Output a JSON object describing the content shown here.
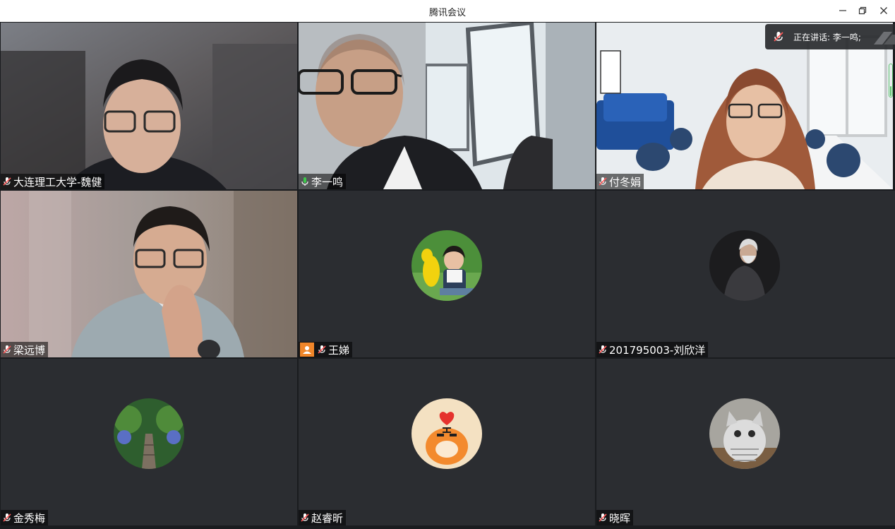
{
  "window": {
    "title": "腾讯会议"
  },
  "speaking_indicator": {
    "label": "正在讲话: 李一鸣;"
  },
  "participants": [
    {
      "name": "大连理工大学-魏健",
      "mic": "muted"
    },
    {
      "name": "李一鸣",
      "mic": "active"
    },
    {
      "name": "付冬娟",
      "mic": "muted"
    },
    {
      "name": "梁远博",
      "mic": "muted"
    },
    {
      "name": "王娣",
      "mic": "muted"
    },
    {
      "name": "201795003-刘欣洋",
      "mic": "muted"
    },
    {
      "name": "金秀梅",
      "mic": "muted"
    },
    {
      "name": "赵睿昕",
      "mic": "muted"
    },
    {
      "name": "晓晖",
      "mic": "muted"
    }
  ],
  "colors": {
    "active_mic": "#3cc94b",
    "muted_mic": "#ff5a5a",
    "tile_bg": "#2b2d31",
    "speaking_border": "#2f9e5b",
    "user_badge": "#f0862a"
  },
  "mic_level": 0.3
}
